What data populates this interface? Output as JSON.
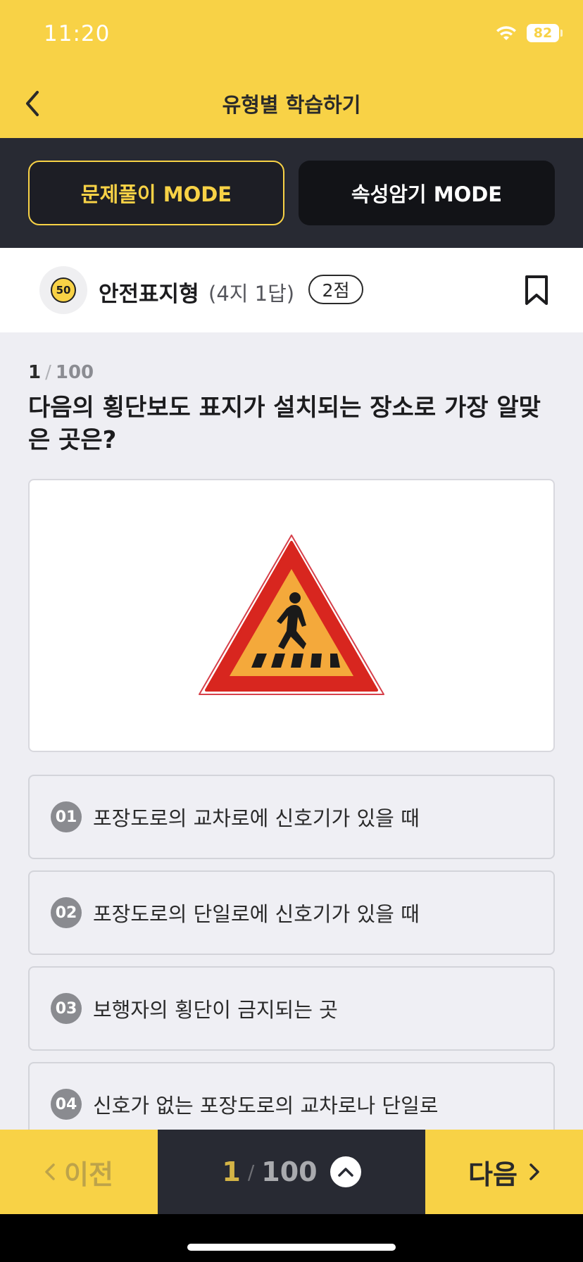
{
  "status_bar": {
    "time": "11:20",
    "battery": "82"
  },
  "header": {
    "title": "유형별 학습하기"
  },
  "modes": {
    "quiz_mode": "문제풀이 MODE",
    "memorize_mode": "속성암기 MODE"
  },
  "category": {
    "icon_text": "50",
    "title": "안전표지형",
    "subtitle": "(4지 1답)",
    "points": "2점"
  },
  "question": {
    "current": "1",
    "total": "100",
    "text": "다음의 횡단보도 표지가 설치되는 장소로 가장 알맞은 곳은?"
  },
  "choices": [
    {
      "num": "01",
      "text": "포장도로의 교차로에 신호기가 있을 때"
    },
    {
      "num": "02",
      "text": "포장도로의 단일로에 신호기가 있을 때"
    },
    {
      "num": "03",
      "text": "보행자의 횡단이 금지되는 곳"
    },
    {
      "num": "04",
      "text": "신호가 없는 포장도로의 교차로나 단일로"
    }
  ],
  "bottom_nav": {
    "prev_label": "이전",
    "current": "1",
    "total": "100",
    "next_label": "다음"
  },
  "colors": {
    "accent": "#f8d246",
    "dark": "#282a33"
  },
  "icons": [
    "back-arrow-icon",
    "wifi-icon",
    "battery-icon",
    "speed-limit-icon",
    "bookmark-icon",
    "crosswalk-sign-icon",
    "chevron-left-icon",
    "chevron-up-icon",
    "chevron-right-icon"
  ]
}
